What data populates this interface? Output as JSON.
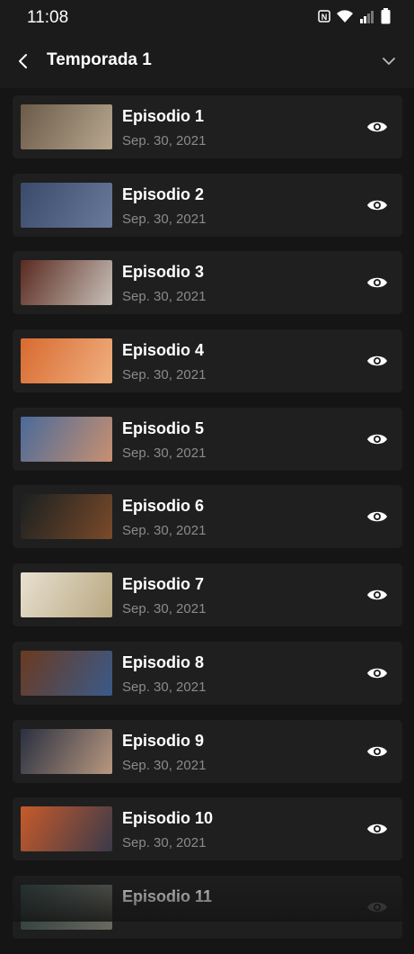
{
  "status": {
    "time": "11:08"
  },
  "header": {
    "title": "Temporada 1"
  },
  "episodes": [
    {
      "title": "Episodio 1",
      "date": "Sep. 30, 2021",
      "thumb": [
        "#6a5a48",
        "#b8a890"
      ]
    },
    {
      "title": "Episodio 2",
      "date": "Sep. 30, 2021",
      "thumb": [
        "#3a4a6a",
        "#6a7a9a"
      ]
    },
    {
      "title": "Episodio 3",
      "date": "Sep. 30, 2021",
      "thumb": [
        "#5a2a20",
        "#c8c0b8"
      ]
    },
    {
      "title": "Episodio 4",
      "date": "Sep. 30, 2021",
      "thumb": [
        "#d86a30",
        "#f0b080"
      ]
    },
    {
      "title": "Episodio 5",
      "date": "Sep. 30, 2021",
      "thumb": [
        "#4a6a9a",
        "#c89070"
      ]
    },
    {
      "title": "Episodio 6",
      "date": "Sep. 30, 2021",
      "thumb": [
        "#1a2020",
        "#7a4a2a"
      ]
    },
    {
      "title": "Episodio 7",
      "date": "Sep. 30, 2021",
      "thumb": [
        "#e8e0d0",
        "#b8a880"
      ]
    },
    {
      "title": "Episodio 8",
      "date": "Sep. 30, 2021",
      "thumb": [
        "#6a3a20",
        "#3a5a8a"
      ]
    },
    {
      "title": "Episodio 9",
      "date": "Sep. 30, 2021",
      "thumb": [
        "#2a3040",
        "#b89880"
      ]
    },
    {
      "title": "Episodio 10",
      "date": "Sep. 30, 2021",
      "thumb": [
        "#c85a2a",
        "#3a3a4a"
      ]
    },
    {
      "title": "Episodio 11",
      "date": "",
      "thumb": [
        "#2a3a3a",
        "#6a6a60"
      ]
    }
  ]
}
